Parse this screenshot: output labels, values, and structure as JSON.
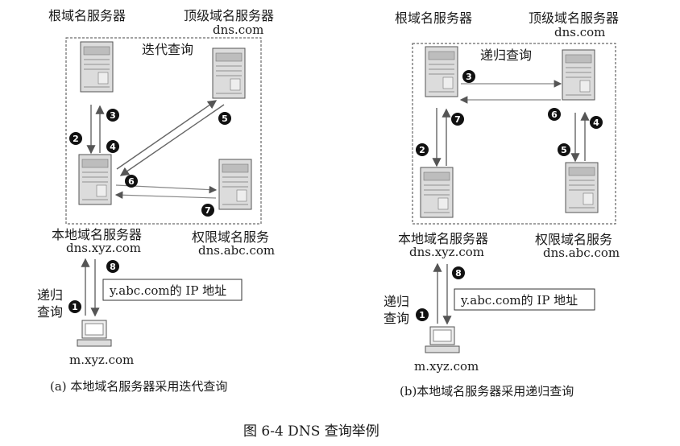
{
  "left": {
    "root_label": "根域名服务器",
    "tld_label": "顶级域名服务器",
    "tld_host": "dns.com",
    "box_title": "迭代查询",
    "local_label": "本地域名服务器",
    "local_host": "dns.xyz.com",
    "auth_label": "权限域名服务",
    "auth_host": "dns.abc.com",
    "answer": "y.abc.com的 IP 地址",
    "query_type_line1": "递归",
    "query_type_line2": "查询",
    "client_host": "m.xyz.com",
    "caption": "(a) 本地域名服务器采用迭代查询",
    "steps": [
      "1",
      "2",
      "3",
      "4",
      "5",
      "6",
      "7",
      "8"
    ]
  },
  "right": {
    "root_label": "根域名服务器",
    "tld_label": "顶级域名服务器",
    "tld_host": "dns.com",
    "box_title": "递归查询",
    "local_label": "本地域名服务器",
    "local_host": "dns.xyz.com",
    "auth_label": "权限域名服务",
    "auth_host": "dns.abc.com",
    "answer": "y.abc.com的 IP 地址",
    "query_type_line1": "递归",
    "query_type_line2": "查询",
    "client_host": "m.xyz.com",
    "caption": "(b)本地域名服务器采用递归查询",
    "steps": [
      "1",
      "2",
      "3",
      "4",
      "5",
      "6",
      "7",
      "8"
    ]
  },
  "figure_caption": "图 6-4    DNS 查询举例"
}
